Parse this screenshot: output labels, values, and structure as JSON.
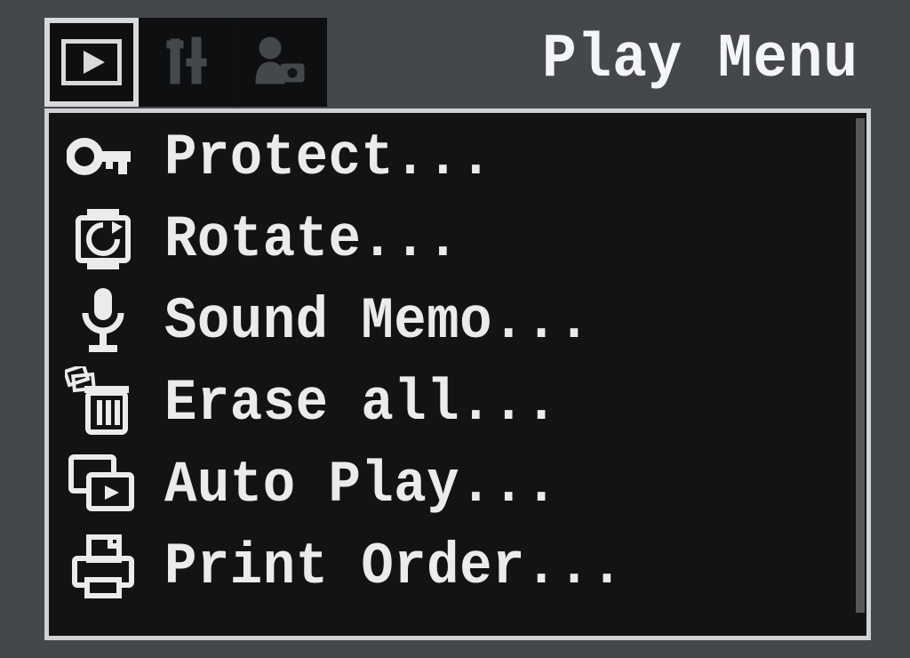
{
  "header": {
    "title": "Play Menu",
    "tabs": [
      {
        "name": "play",
        "selected": true
      },
      {
        "name": "setup",
        "selected": false
      },
      {
        "name": "myCamera",
        "selected": false
      }
    ]
  },
  "menu": {
    "items": [
      {
        "label": "Protect...",
        "icon": "key-icon"
      },
      {
        "label": "Rotate...",
        "icon": "rotate-icon"
      },
      {
        "label": "Sound Memo...",
        "icon": "mic-icon"
      },
      {
        "label": "Erase all...",
        "icon": "trash-icon"
      },
      {
        "label": "Auto Play...",
        "icon": "slideshow-icon"
      },
      {
        "label": "Print Order...",
        "icon": "print-icon"
      }
    ]
  }
}
